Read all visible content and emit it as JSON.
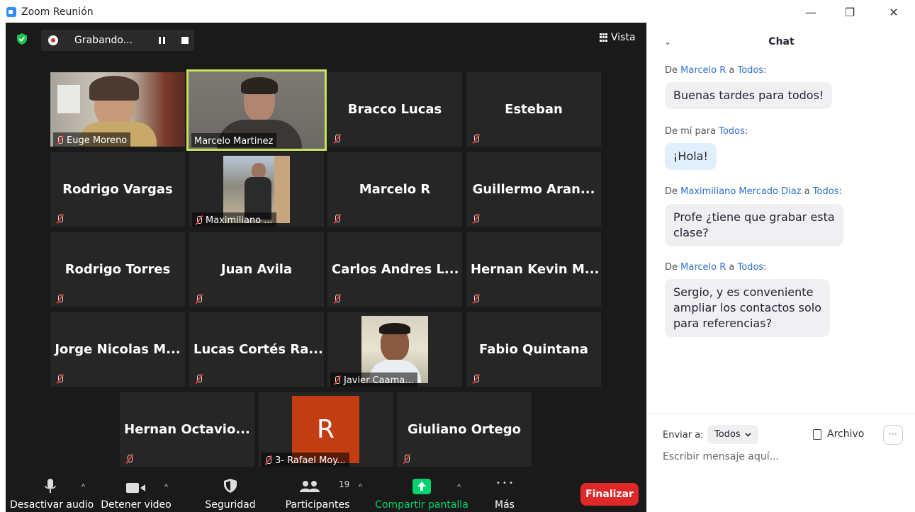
{
  "window": {
    "title": "Zoom Reunión",
    "minimize": "—",
    "restore": "❐",
    "close": "✕"
  },
  "topbar": {
    "recording_label": "Grabando...",
    "view_label": "Vista"
  },
  "participants": [
    {
      "name": "Euge Moreno",
      "type": "video"
    },
    {
      "name": "Marcelo Martinez",
      "type": "video",
      "active": true
    },
    {
      "name": "Bracco Lucas",
      "type": "name"
    },
    {
      "name": "Esteban",
      "type": "name"
    },
    {
      "name": "Rodrigo Vargas",
      "type": "name"
    },
    {
      "name": "Maximiliano ...",
      "type": "video"
    },
    {
      "name": "Marcelo R",
      "type": "name"
    },
    {
      "name": "Guillermo  Aran...",
      "type": "name"
    },
    {
      "name": "Rodrigo Torres",
      "type": "name"
    },
    {
      "name": "Juan Avila",
      "type": "name"
    },
    {
      "name": "Carlos Andres L...",
      "type": "name"
    },
    {
      "name": "Hernan Kevin M...",
      "type": "name"
    },
    {
      "name": "Jorge Nicolas M...",
      "type": "name"
    },
    {
      "name": "Lucas Cortés Ra...",
      "type": "name"
    },
    {
      "name": "Javier Caama...",
      "type": "video"
    },
    {
      "name": "Fabio Quintana",
      "type": "name"
    },
    {
      "name": "Hernan  Octavio...",
      "type": "name"
    },
    {
      "name": "3- Rafael Moy...",
      "type": "avatar",
      "initial": "R"
    },
    {
      "name": "Giuliano Ortego",
      "type": "name"
    }
  ],
  "toolbar": {
    "mute_label": "Desactivar audio",
    "video_label": "Detener video",
    "security_label": "Seguridad",
    "participants_label": "Participantes",
    "participants_count": "19",
    "share_label": "Compartir pantalla",
    "more_label": "Más",
    "end_label": "Finalizar",
    "more_dots": "• • •",
    "caret": "^"
  },
  "chat": {
    "title": "Chat",
    "collapse": "⌄",
    "messages": [
      {
        "prefix": "De ",
        "from": "Marcelo R",
        "mid": " a ",
        "to": "Todos",
        "suffix": ":",
        "text": "Buenas tardes para todos!"
      },
      {
        "prefix": "De mí para ",
        "from": "",
        "mid": "",
        "to": "Todos",
        "suffix": ":",
        "text": "¡Hola!"
      },
      {
        "prefix": "De ",
        "from": "Maximiliano Mercado Diaz",
        "mid": " a ",
        "to": "Todos",
        "suffix": ":",
        "text_line1": "Profe ¿tiene que grabar esta",
        "text_line2": "clase?"
      },
      {
        "prefix": "De ",
        "from": "Marcelo R",
        "mid": " a ",
        "to": "Todos",
        "suffix": ":",
        "text_line1": "Sergio, y es conveniente",
        "text_line2": "ampliar los contactos solo",
        "text_line3": "para referencias?"
      }
    ],
    "send_to_label": "Enviar a:",
    "send_to_value": "Todos",
    "file_label": "Archivo",
    "more_icon": "···",
    "input_placeholder": "Escribir mensaje aquí..."
  },
  "colors": {
    "accent_green": "#00d36b",
    "end_red": "#e02828",
    "chat_link": "#2d6fd1",
    "active_speaker": "#c8e05a"
  }
}
